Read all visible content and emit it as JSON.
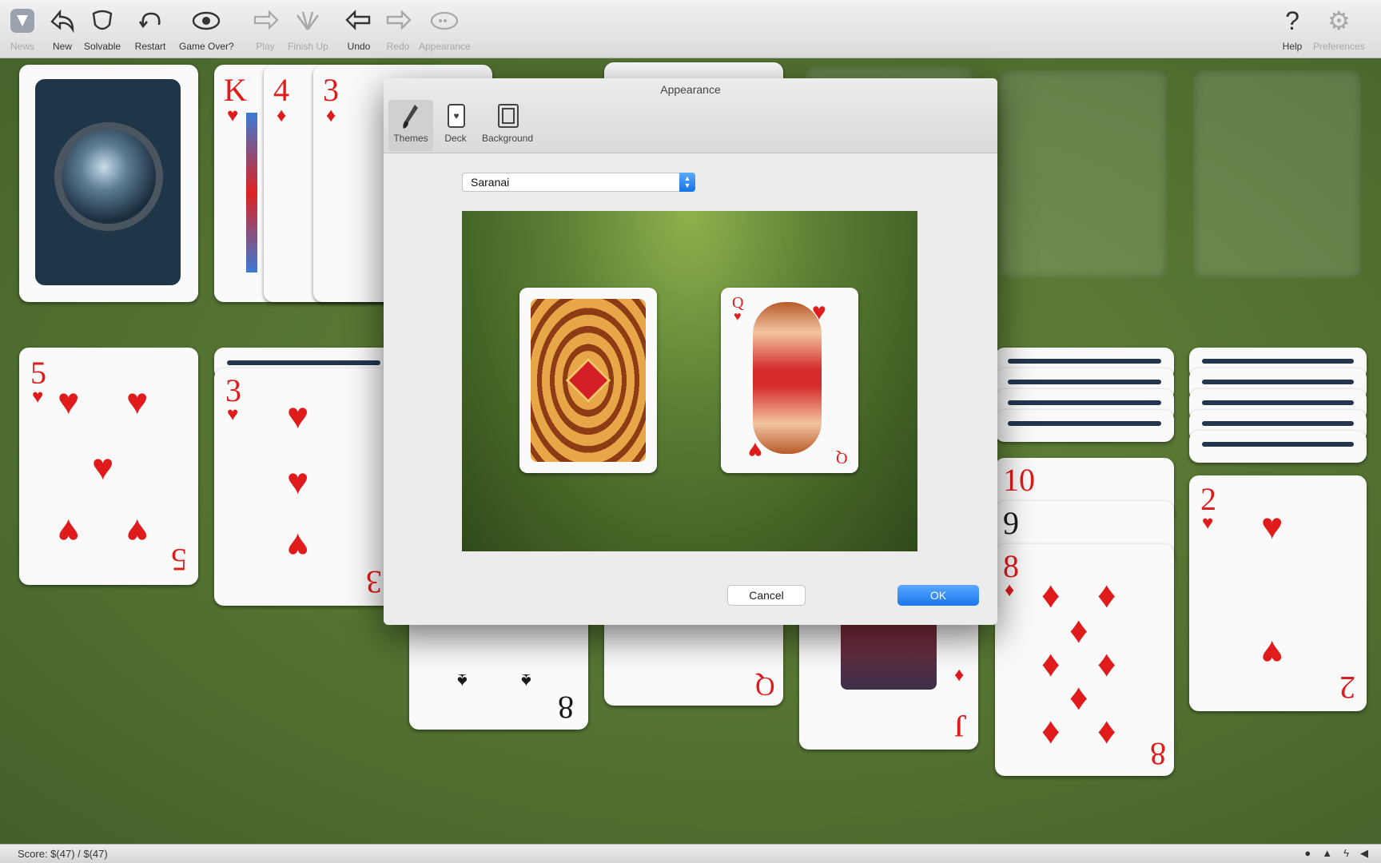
{
  "toolbar": {
    "items": [
      {
        "label": "News",
        "icon": "news-icon",
        "enabled": false
      },
      {
        "label": "New",
        "icon": "new-game-icon",
        "enabled": true
      },
      {
        "label": "Solvable",
        "icon": "solvable-icon",
        "enabled": true
      },
      {
        "label": "Restart",
        "icon": "restart-icon",
        "enabled": true
      },
      {
        "label": "Game Over?",
        "icon": "eye-icon",
        "enabled": true
      },
      {
        "label": "Play",
        "icon": "play-icon",
        "enabled": false
      },
      {
        "label": "Finish Up",
        "icon": "finish-up-icon",
        "enabled": false
      },
      {
        "label": "Undo",
        "icon": "undo-icon",
        "enabled": true
      },
      {
        "label": "Redo",
        "icon": "redo-icon",
        "enabled": false
      },
      {
        "label": "Appearance",
        "icon": "appearance-icon",
        "enabled": false
      }
    ],
    "right_items": [
      {
        "label": "Help",
        "icon": "help-icon",
        "enabled": true
      },
      {
        "label": "Preferences",
        "icon": "gear-icon",
        "enabled": false
      }
    ]
  },
  "board": {
    "waste": [
      {
        "rank": "K",
        "suit": "♥"
      },
      {
        "rank": "4",
        "suit": "♦"
      },
      {
        "rank": "3",
        "suit": "♦"
      }
    ],
    "tableau": [
      {
        "rank": "5",
        "suit": "♥"
      },
      {
        "rank": "3",
        "suit": "♥"
      },
      {
        "rank": "8",
        "suit": "♠"
      },
      {
        "rank": "Q",
        "suit": "♦"
      },
      {
        "rank": "J",
        "suit": "♦"
      },
      {
        "rank": "10",
        "suit": "♦"
      },
      {
        "rank": "9",
        "suit": "♠"
      },
      {
        "rank": "8",
        "suit": "♦"
      },
      {
        "rank": "2",
        "suit": "♥"
      }
    ]
  },
  "dialog": {
    "title": "Appearance",
    "tabs": [
      {
        "label": "Themes",
        "icon": "brush-icon",
        "selected": true
      },
      {
        "label": "Deck",
        "icon": "deck-icon",
        "selected": false
      },
      {
        "label": "Background",
        "icon": "background-icon",
        "selected": false
      }
    ],
    "theme_select": {
      "value": "Saranai"
    },
    "preview_card": {
      "rank": "Q",
      "suit": "♥"
    },
    "cancel_label": "Cancel",
    "ok_label": "OK"
  },
  "status": {
    "score": "Score: $(47) / $(47)"
  },
  "colors": {
    "felt": "#557432",
    "card_red": "#e01b1b",
    "accent_blue": "#1a76ec"
  }
}
